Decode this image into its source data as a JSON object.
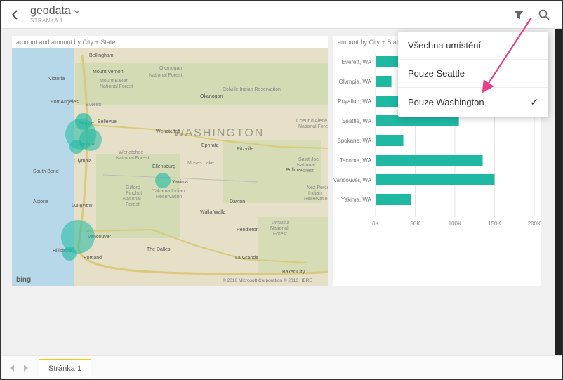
{
  "header": {
    "title": "geodata",
    "subtitle": "STRÁNKA 1"
  },
  "dropdown": {
    "items": [
      {
        "label": "Všechna umístění",
        "checked": false
      },
      {
        "label": "Pouze Seattle",
        "checked": false
      },
      {
        "label": "Pouze Washington",
        "checked": true
      }
    ]
  },
  "map": {
    "title": "amount and amount by City + State",
    "state_label": "WASHINGTON",
    "attribution_left": "bing",
    "attribution_right": "© 2016 Microsoft Corporation   © 2016 HERE",
    "cities": [
      "Bellingham",
      "Victoria",
      "Mount Vernon",
      "Port Angeles",
      "Seattle",
      "Bellevue",
      "Tacoma",
      "Olympia",
      "South Bend",
      "Astoria",
      "Longview",
      "Vancouver",
      "Hillsboro",
      "Portland",
      "Yakima",
      "Okanogan",
      "Ephrata",
      "Wenatchee",
      "Ritzville",
      "Moses Lake",
      "Ellensburg",
      "Pendleton",
      "Walla Walla",
      "Dayton",
      "The Dalles",
      "La Grande",
      "Baker City",
      "Pullman"
    ]
  },
  "chart_data": {
    "type": "bar",
    "title": "amount by City + State",
    "orientation": "horizontal",
    "categories": [
      "Everett, WA",
      "Olympia, WA",
      "Puyallup, WA",
      "Seattle, WA",
      "Spokane, WA",
      "Tacoma, WA",
      "Vancouver, WA",
      "Yakima, WA"
    ],
    "values": [
      30000,
      20000,
      140000,
      105000,
      35000,
      135000,
      150000,
      45000
    ],
    "xlabel": "",
    "ylabel": "",
    "xticks": [
      0,
      50000,
      100000,
      150000,
      200000
    ],
    "xtick_labels": [
      "0K",
      "50K",
      "100K",
      "150K",
      "200K"
    ],
    "xlim": [
      0,
      200000
    ],
    "color": "#1fb9a3"
  },
  "footer": {
    "page_tab": "Stránka 1"
  }
}
